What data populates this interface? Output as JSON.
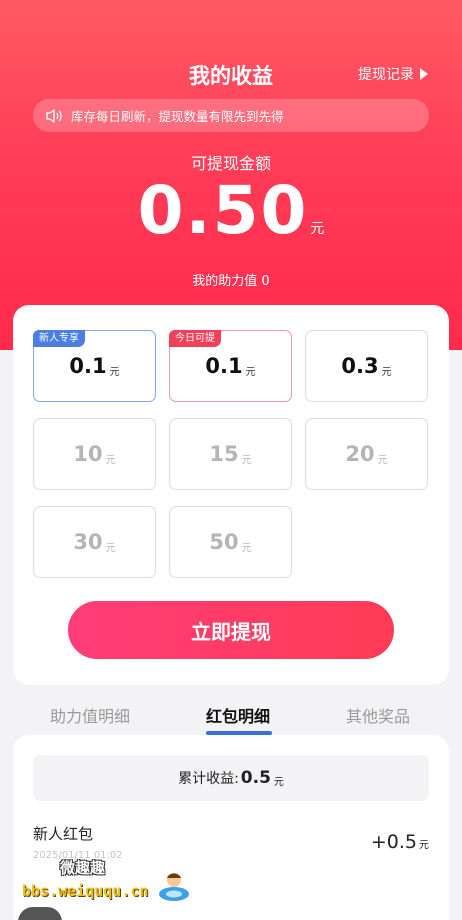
{
  "header": {
    "title": "我的收益",
    "record_link": "提现记录",
    "notice": "库存每日刷新，提现数量有限先到先得",
    "balance_label": "可提现金额",
    "balance": "0.50",
    "balance_unit": "元",
    "assist_value": "我的助力值 0"
  },
  "options": [
    {
      "value": "0.1",
      "unit": "元",
      "tag": "新人专享",
      "state": "enabled"
    },
    {
      "value": "0.1",
      "unit": "元",
      "tag": "今日可提",
      "state": "enabled"
    },
    {
      "value": "0.3",
      "unit": "元",
      "tag": "",
      "state": "enabled"
    },
    {
      "value": "10",
      "unit": "元",
      "tag": "",
      "state": "disabled"
    },
    {
      "value": "15",
      "unit": "元",
      "tag": "",
      "state": "disabled"
    },
    {
      "value": "20",
      "unit": "元",
      "tag": "",
      "state": "disabled"
    },
    {
      "value": "30",
      "unit": "元",
      "tag": "",
      "state": "disabled"
    },
    {
      "value": "50",
      "unit": "元",
      "tag": "",
      "state": "disabled"
    }
  ],
  "withdraw_button": "立即提现",
  "tabs": [
    {
      "label": "助力值明细",
      "active": false
    },
    {
      "label": "红包明细",
      "active": true
    },
    {
      "label": "其他奖品",
      "active": false
    }
  ],
  "summary": {
    "label": "累计收益:",
    "value": "0.5",
    "unit": "元"
  },
  "records": [
    {
      "title": "新人红包",
      "time": "2025/01/11 01:02",
      "amount": "+0.5",
      "unit": "元"
    }
  ],
  "watermark": {
    "line1": "微趣趣",
    "line2": "bbs.weiququ.cn"
  },
  "colors": {
    "accent": "#ff3d57",
    "tab_indicator": "#3a6fd8",
    "tag_blue": "#4a7fe0",
    "tag_red": "#f0405a"
  }
}
